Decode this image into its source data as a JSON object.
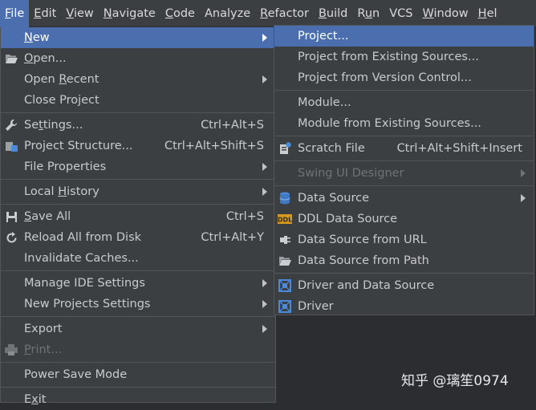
{
  "menubar": [
    {
      "label": "File",
      "active": true
    },
    {
      "label": "Edit"
    },
    {
      "label": "View"
    },
    {
      "label": "Navigate"
    },
    {
      "label": "Code"
    },
    {
      "label": "Analyze"
    },
    {
      "label": "Refactor"
    },
    {
      "label": "Build"
    },
    {
      "label": "Run"
    },
    {
      "label": "VCS"
    },
    {
      "label": "Window"
    },
    {
      "label": "Hel"
    }
  ],
  "file_menu": {
    "new": {
      "label": "New"
    },
    "open": {
      "label": "Open...",
      "icon": "folder-open-icon"
    },
    "open_recent": {
      "label": "Open Recent"
    },
    "close_project": {
      "label": "Close Project"
    },
    "settings": {
      "label": "Settings...",
      "shortcut": "Ctrl+Alt+S",
      "icon": "wrench-icon"
    },
    "project_structure": {
      "label": "Project Structure...",
      "shortcut": "Ctrl+Alt+Shift+S",
      "icon": "project-structure-icon"
    },
    "file_properties": {
      "label": "File Properties"
    },
    "local_history": {
      "label": "Local History"
    },
    "save_all": {
      "label": "Save All",
      "shortcut": "Ctrl+S",
      "icon": "save-icon"
    },
    "reload": {
      "label": "Reload All from Disk",
      "shortcut": "Ctrl+Alt+Y",
      "icon": "reload-icon"
    },
    "invalidate": {
      "label": "Invalidate Caches..."
    },
    "manage_ide": {
      "label": "Manage IDE Settings"
    },
    "new_projects_settings": {
      "label": "New Projects Settings"
    },
    "export": {
      "label": "Export"
    },
    "print": {
      "label": "Print...",
      "icon": "print-icon"
    },
    "power_save": {
      "label": "Power Save Mode"
    },
    "exit": {
      "label": "Exit"
    }
  },
  "new_menu": {
    "project": {
      "label": "Project..."
    },
    "project_existing": {
      "label": "Project from Existing Sources..."
    },
    "project_vcs": {
      "label": "Project from Version Control..."
    },
    "module": {
      "label": "Module..."
    },
    "module_existing": {
      "label": "Module from Existing Sources..."
    },
    "scratch_file": {
      "label": "Scratch File",
      "shortcut": "Ctrl+Alt+Shift+Insert",
      "icon": "scratch-file-icon"
    },
    "swing_ui": {
      "label": "Swing UI Designer"
    },
    "data_source": {
      "label": "Data Source",
      "icon": "database-icon"
    },
    "ddl_data_source": {
      "label": "DDL Data Source",
      "icon": "ddl-icon"
    },
    "data_source_url": {
      "label": "Data Source from URL",
      "icon": "plug-icon"
    },
    "data_source_path": {
      "label": "Data Source from Path",
      "icon": "folder-icon"
    },
    "driver_and_data_source": {
      "label": "Driver and Data Source",
      "icon": "driver-icon"
    },
    "driver": {
      "label": "Driver",
      "icon": "driver-icon"
    }
  },
  "watermark": "知乎 @璃笙0974"
}
